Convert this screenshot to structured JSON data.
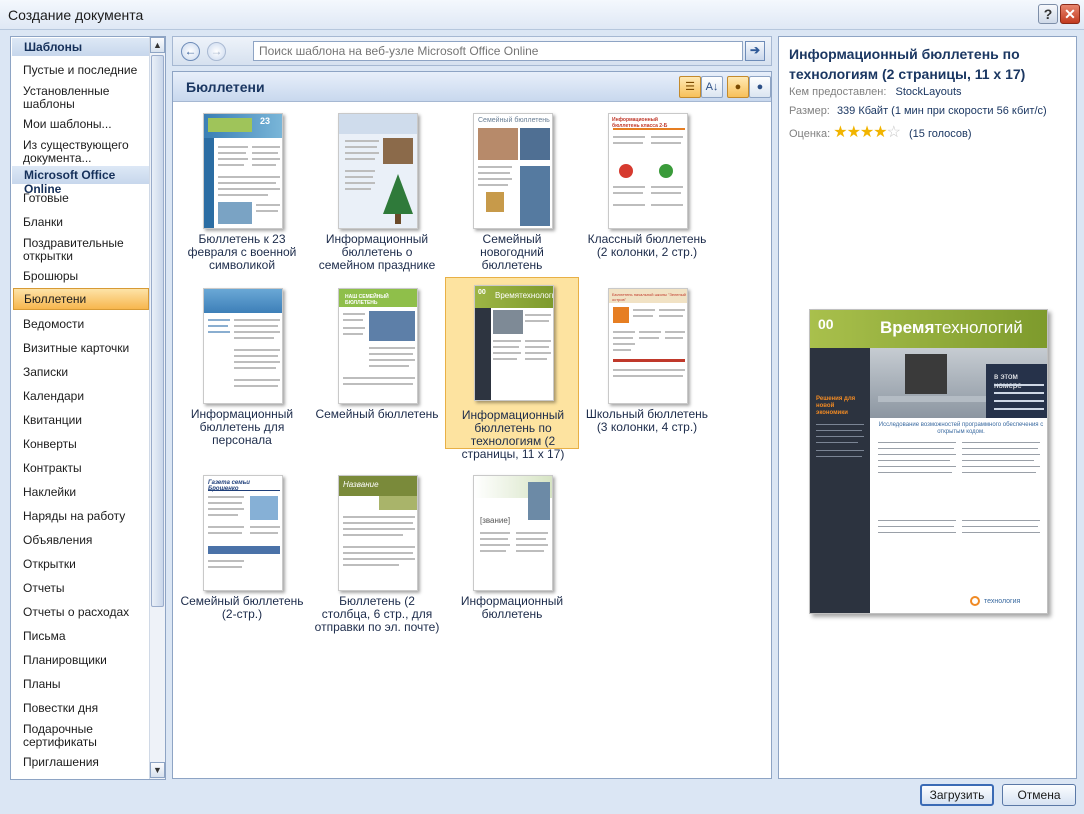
{
  "window": {
    "title": "Создание документа",
    "help_label": "?",
    "close_label": "✕"
  },
  "sidebar": {
    "header": "Шаблоны",
    "items_top": [
      "Пустые и последние",
      "Установленные шаблоны",
      "Мои шаблоны...",
      "Из существующего документа..."
    ],
    "online_header": "Microsoft Office Online",
    "items_online": [
      "Готовые",
      "Бланки",
      "Поздравительные открытки",
      "Брошюры",
      "Бюллетени",
      "Ведомости",
      "Визитные карточки",
      "Записки",
      "Календари",
      "Квитанции",
      "Конверты",
      "Контракты",
      "Наклейки",
      "Наряды на работу",
      "Объявления",
      "Открытки",
      "Отчеты",
      "Отчеты о расходах",
      "Письма",
      "Планировщики",
      "Планы",
      "Повестки дня",
      "Подарочные сертификаты",
      "Приглашения"
    ],
    "selected": "Бюллетени",
    "scroll_up": "▲",
    "scroll_down": "▼"
  },
  "nav": {
    "back_icon": "back-arrow-icon",
    "forward_icon": "forward-arrow-icon",
    "search_placeholder": "Поиск шаблона на веб-узле Microsoft Office Online",
    "go_label": "➔"
  },
  "center": {
    "title": "Бюллетени",
    "templates": [
      {
        "label": "Бюллетень к 23 февраля с военной символикой"
      },
      {
        "label": "Информационный бюллетень о семейном празднике"
      },
      {
        "label": "Семейный новогодний бюллетень"
      },
      {
        "label": "Классный бюллетень (2 колонки, 2 стр.)"
      },
      {
        "label": "Информационный бюллетень для персонала"
      },
      {
        "label": "Семейный бюллетень"
      },
      {
        "label": "Информационный бюллетень по технологиям (2 страницы, 11 x 17)"
      },
      {
        "label": "Школьный бюллетень (3 колонки, 4 стр.)"
      },
      {
        "label": "Семейный бюллетень (2-стр.)"
      },
      {
        "label": "Бюллетень (2 столбца, 6 стр., для отправки по эл. почте)"
      },
      {
        "label": "Информационный бюллетень"
      }
    ],
    "selected_index": 6,
    "thumb_texts": {
      "t1_page": "23",
      "t3_title": "Семейный бюллетень",
      "t4_title": "Информационный бюллетень класса 2-Б",
      "t6_title": "НАШ СЕМЕЙНЫЙ БЮЛЛЕТЕНЬ",
      "t7_num": "00",
      "t7_title": "Времятехнологий",
      "t8_title": "Бюллетень начальной школы \"Зеленый остров\"",
      "t9_title": "Газета семьи Брошенко",
      "t10_title": "Название",
      "t11_title": "[звание]"
    }
  },
  "details": {
    "title": "Информационный бюллетень по технологиям (2 страницы, 11 x 17)",
    "provider_label": "Кем предоставлен:",
    "provider_value": "StockLayouts",
    "size_label": "Размер:",
    "size_value": "339 Кбайт (1 мин при скорости 56 кбит/с)",
    "rating_label": "Оценка:",
    "rating_stars": 4,
    "rating_max": 5,
    "rating_votes": "(15 голосов)",
    "preview": {
      "issue": "00",
      "brand_bold": "Время",
      "brand_rest": "технологий",
      "in_issue": "в этом номере",
      "side_heading": "Решения для новой экономики",
      "headline": "Исследование возможностей программного обеспечения с открытым кодом.",
      "logo_text": "технология"
    }
  },
  "footer": {
    "load_label": "Загрузить",
    "cancel_label": "Отмена"
  }
}
